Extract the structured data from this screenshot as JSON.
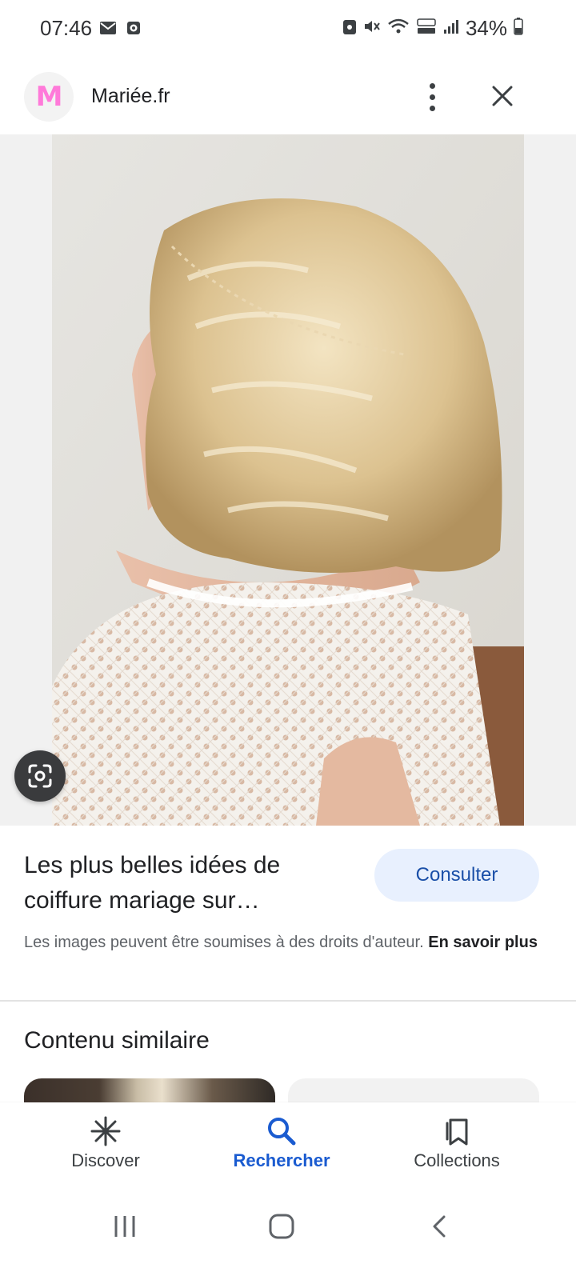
{
  "status_bar": {
    "time": "07:46",
    "battery": "34%",
    "icons": [
      "mail-icon",
      "alarm-icon",
      "android-icon",
      "mute-icon",
      "wifi-icon",
      "volte-icon",
      "signal-icon",
      "battery-icon"
    ]
  },
  "header": {
    "site_initial": "M",
    "site_name": "Mariée.fr",
    "accent_color": "#ff7ad9"
  },
  "result": {
    "title": "Les plus belles idées de coiffure mariage sur…",
    "consult_label": "Consulter",
    "copyright_text": "Les images peuvent être soumises à des droits d'auteur.",
    "learn_more": "En savoir plus"
  },
  "similar": {
    "title": "Contenu similaire"
  },
  "bottom_nav": {
    "items": [
      {
        "label": "Discover",
        "icon": "asterisk-icon"
      },
      {
        "label": "Rechercher",
        "icon": "search-icon",
        "active": true
      },
      {
        "label": "Collections",
        "icon": "bookmarks-icon"
      }
    ],
    "active_color": "#1a5bd0"
  },
  "system_nav": {
    "icons": [
      "recents-icon",
      "home-icon",
      "back-icon"
    ]
  }
}
